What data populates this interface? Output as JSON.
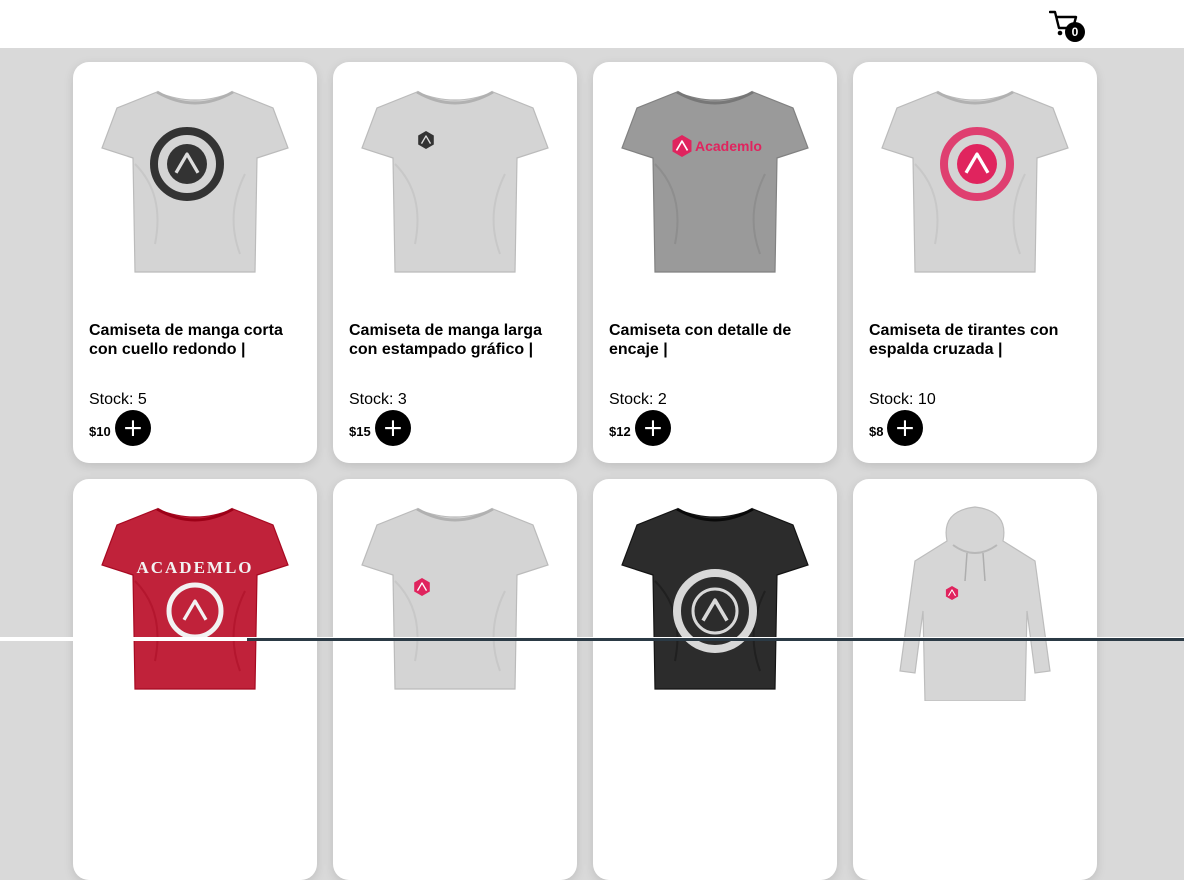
{
  "header": {
    "cart_icon": "cart-icon",
    "cart_count": "0"
  },
  "products": [
    {
      "name": "Camiseta de manga corta con cuello redondo |",
      "stock_label": "Stock:",
      "stock": "5",
      "currency": "$",
      "price": "10",
      "add_label": "+",
      "tshirt_color": "#d4d4d4",
      "print": "circle-badge-dark"
    },
    {
      "name": "Camiseta de manga larga con estampado gráfico |",
      "stock_label": "Stock:",
      "stock": "3",
      "currency": "$",
      "price": "15",
      "add_label": "+",
      "tshirt_color": "#d4d4d4",
      "print": "small-hex-dark"
    },
    {
      "name": "Camiseta con detalle de encaje |",
      "stock_label": "Stock:",
      "stock": "2",
      "currency": "$",
      "price": "12",
      "add_label": "+",
      "tshirt_color": "#9a9a9a",
      "print": "wordmark-pink",
      "print_text": "Academlo"
    },
    {
      "name": "Camiseta de tirantes con espalda cruzada |",
      "stock_label": "Stock:",
      "stock": "10",
      "currency": "$",
      "price": "8",
      "add_label": "+",
      "tshirt_color": "#d4d4d4",
      "print": "circle-badge-pink"
    },
    {
      "tshirt_color": "#c0223a",
      "print": "academlo-arch-white",
      "print_text": "ACADEMLO"
    },
    {
      "tshirt_color": "#d4d4d4",
      "print": "small-hex-pink"
    },
    {
      "tshirt_color": "#2c2c2c",
      "print": "circle-badge-light"
    },
    {
      "garment": "hoodie",
      "tshirt_color": "#d6d6d6",
      "print": "small-hex-pink"
    }
  ],
  "colors": {
    "page_bg": "#d9d9d9",
    "card_bg": "#ffffff",
    "button": "#000000",
    "accent_pink": "#e0245e"
  }
}
